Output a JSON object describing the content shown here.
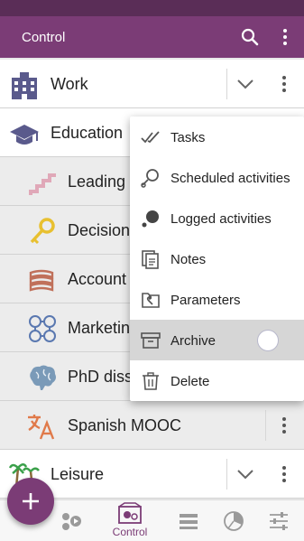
{
  "appbar": {
    "title": "Control",
    "search_icon": "search-icon",
    "more_icon": "more-vert-icon"
  },
  "list": {
    "work": {
      "label": "Work",
      "icon": "building-icon"
    },
    "education": {
      "label": "Education",
      "icon": "graduation-cap-icon"
    },
    "items": [
      {
        "label": "Leading",
        "icon": "stairs-icon"
      },
      {
        "label": "Decision",
        "icon": "key-icon"
      },
      {
        "label": "Account",
        "icon": "books-icon"
      },
      {
        "label": "Marketin",
        "icon": "network-icon"
      },
      {
        "label": "PhD diss",
        "icon": "brain-icon"
      },
      {
        "label": "Spanish MOOC",
        "icon": "translate-icon"
      }
    ],
    "leisure": {
      "label": "Leisure",
      "icon": "palm-trees-icon"
    }
  },
  "menu": {
    "items": [
      {
        "label": "Tasks",
        "icon": "double-check-icon"
      },
      {
        "label": "Scheduled activities",
        "icon": "scheduled-activity-icon"
      },
      {
        "label": "Logged activities",
        "icon": "logged-activity-icon"
      },
      {
        "label": "Notes",
        "icon": "notes-icon"
      },
      {
        "label": "Parameters",
        "icon": "parameters-icon"
      },
      {
        "label": "Archive",
        "icon": "archive-icon"
      },
      {
        "label": "Delete",
        "icon": "trash-icon"
      }
    ],
    "highlighted": "Archive"
  },
  "bottom_nav": {
    "items": [
      "activities",
      "Control",
      "list",
      "stats",
      "settings"
    ],
    "active_label": "Control"
  },
  "colors": {
    "primary": "#7b3c76",
    "status_bar": "#5a2d57"
  }
}
